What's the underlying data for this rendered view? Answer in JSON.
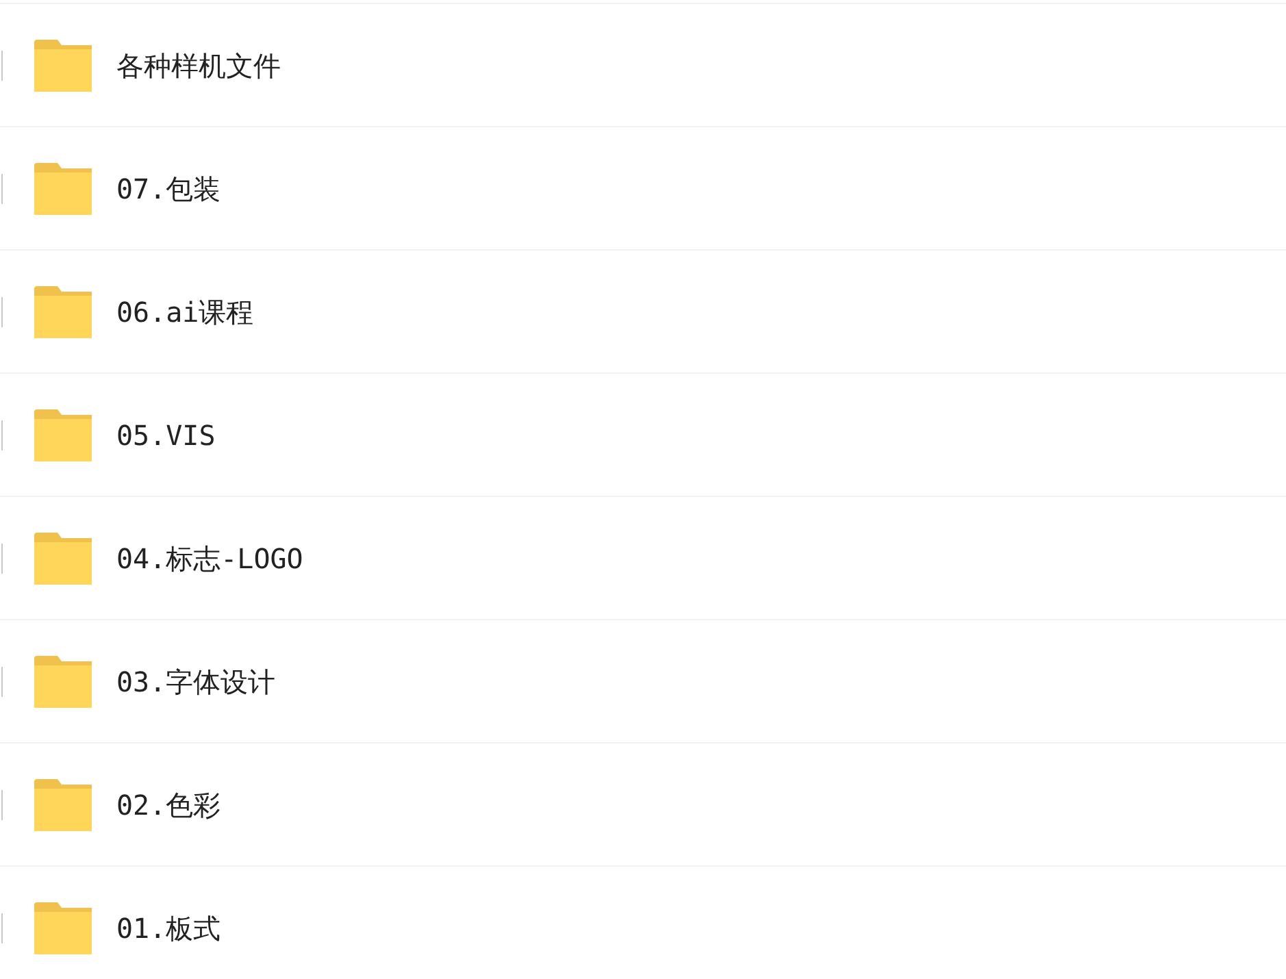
{
  "folders": [
    {
      "name": "各种样机文件",
      "checked": false
    },
    {
      "name": "07.包装",
      "checked": false
    },
    {
      "name": "06.ai课程",
      "checked": false
    },
    {
      "name": "05.VIS",
      "checked": false
    },
    {
      "name": "04.标志-LOGO",
      "checked": false
    },
    {
      "name": "03.字体设计",
      "checked": false
    },
    {
      "name": "02.色彩",
      "checked": false
    },
    {
      "name": "01.板式",
      "checked": false
    }
  ]
}
